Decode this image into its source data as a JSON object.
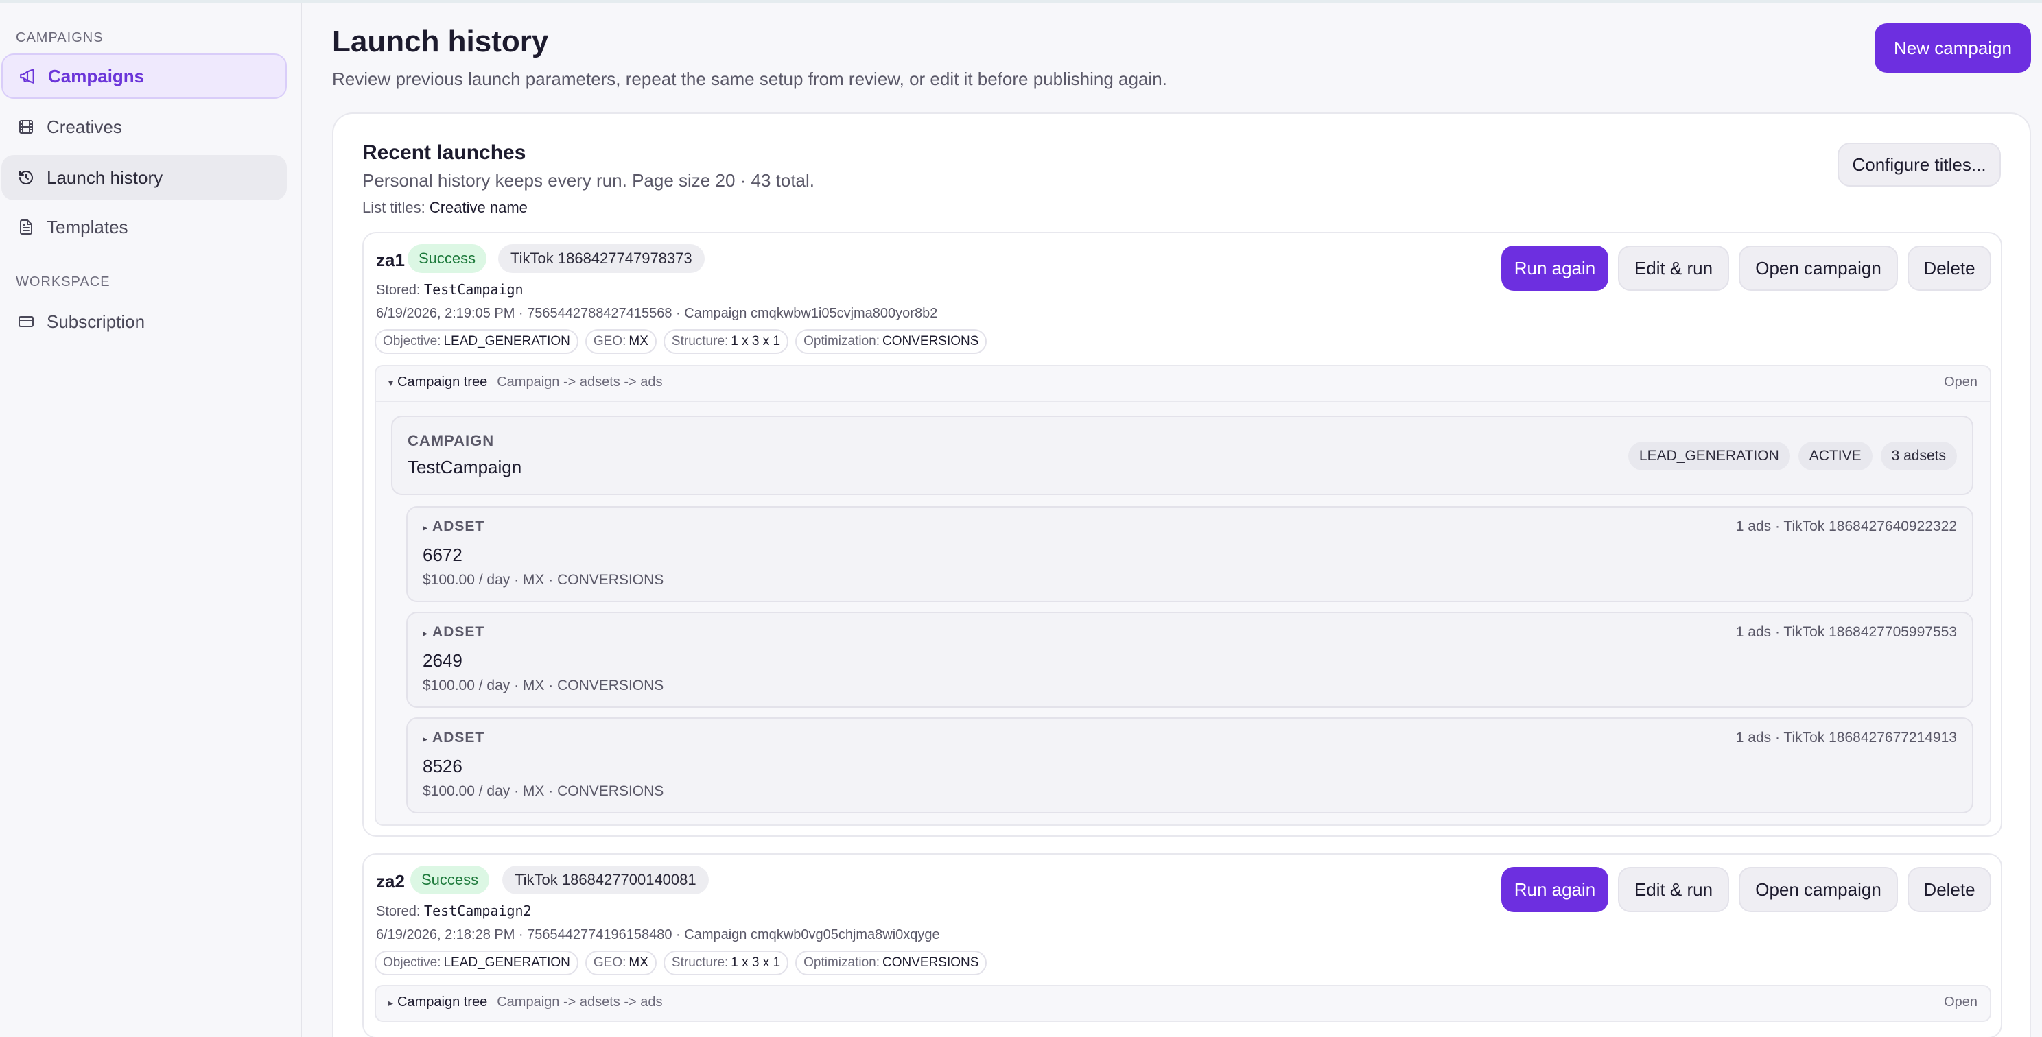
{
  "sidebar": {
    "section_campaigns": "CAMPAIGNS",
    "section_workspace": "WORKSPACE",
    "items": [
      {
        "label": "Campaigns"
      },
      {
        "label": "Creatives"
      },
      {
        "label": "Launch history"
      },
      {
        "label": "Templates"
      },
      {
        "label": "Subscription"
      }
    ]
  },
  "header": {
    "title": "Launch history",
    "subtitle": "Review previous launch parameters, repeat the same setup from review, or edit it before publishing again.",
    "new_campaign": "New campaign"
  },
  "recent": {
    "title": "Recent launches",
    "subtitle": "Personal history keeps every run. Page size 20 · 43 total.",
    "list_titles_label": "List titles:",
    "list_titles_value": "Creative name",
    "configure": "Configure titles..."
  },
  "actions": {
    "run_again": "Run again",
    "edit_run": "Edit & run",
    "open_campaign": "Open campaign",
    "delete": "Delete"
  },
  "labels": {
    "stored": "Stored:",
    "objective": "Objective:",
    "geo": "GEO:",
    "structure": "Structure:",
    "optimization": "Optimization:",
    "tree": "Campaign tree",
    "tree_path": "Campaign -> adsets -> ads",
    "open": "Open",
    "campaign_kind": "CAMPAIGN",
    "adset_kind": "ADSET"
  },
  "launches": [
    {
      "name": "za1",
      "status": "Success",
      "platform": "TikTok 1868427747978373",
      "stored": "TestCampaign",
      "meta": "6/19/2026, 2:19:05 PM · 7565442788427415568 · Campaign cmqkwbw1i05cvjma800yor8b2",
      "objective": "LEAD_GENERATION",
      "geo": "MX",
      "structure": "1 x 3 x 1",
      "optimization": "CONVERSIONS",
      "campaign": {
        "name": "TestCampaign",
        "pills": [
          "LEAD_GENERATION",
          "ACTIVE",
          "3 adsets"
        ]
      },
      "adsets": [
        {
          "name": "6672",
          "details": "$100.00 / day · MX · CONVERSIONS",
          "right": "1 ads · TikTok 1868427640922322"
        },
        {
          "name": "2649",
          "details": "$100.00 / day · MX · CONVERSIONS",
          "right": "1 ads · TikTok 1868427705997553"
        },
        {
          "name": "8526",
          "details": "$100.00 / day · MX · CONVERSIONS",
          "right": "1 ads · TikTok 1868427677214913"
        }
      ]
    },
    {
      "name": "za2",
      "status": "Success",
      "platform": "TikTok 1868427700140081",
      "stored": "TestCampaign2",
      "meta": "6/19/2026, 2:18:28 PM · 7565442774196158480 · Campaign cmqkwb0vg05chjma8wi0xqyge",
      "objective": "LEAD_GENERATION",
      "geo": "MX",
      "structure": "1 x 3 x 1",
      "optimization": "CONVERSIONS"
    }
  ]
}
